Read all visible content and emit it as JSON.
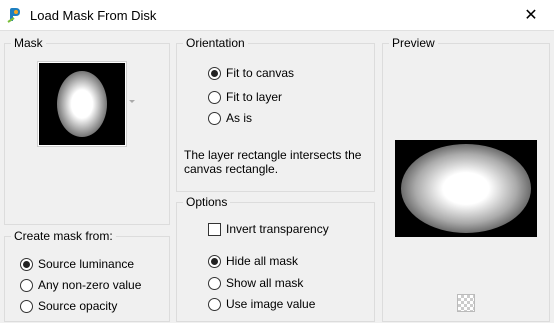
{
  "window": {
    "title": "Load Mask From Disk",
    "close_glyph": "✕"
  },
  "mask": {
    "label": "Mask"
  },
  "create_from": {
    "label": "Create mask from:",
    "options": [
      {
        "label": "Source luminance",
        "selected": true
      },
      {
        "label": "Any non-zero value",
        "selected": false
      },
      {
        "label": "Source opacity",
        "selected": false
      }
    ]
  },
  "orientation": {
    "label": "Orientation",
    "options": [
      {
        "label": "Fit to canvas",
        "selected": true
      },
      {
        "label": "Fit to layer",
        "selected": false
      },
      {
        "label": "As is",
        "selected": false
      }
    ],
    "info": "The layer rectangle intersects the canvas rectangle."
  },
  "options": {
    "label": "Options",
    "invert_label": "Invert transparency",
    "invert_checked": false,
    "radios": [
      {
        "label": "Hide all mask",
        "selected": true
      },
      {
        "label": "Show all mask",
        "selected": false
      },
      {
        "label": "Use image value",
        "selected": false
      }
    ]
  },
  "preview": {
    "label": "Preview"
  },
  "icons": {
    "app": "app-icon",
    "transparency": "checkerboard-icon",
    "dropdown": "dropdown-arrow-icon"
  }
}
